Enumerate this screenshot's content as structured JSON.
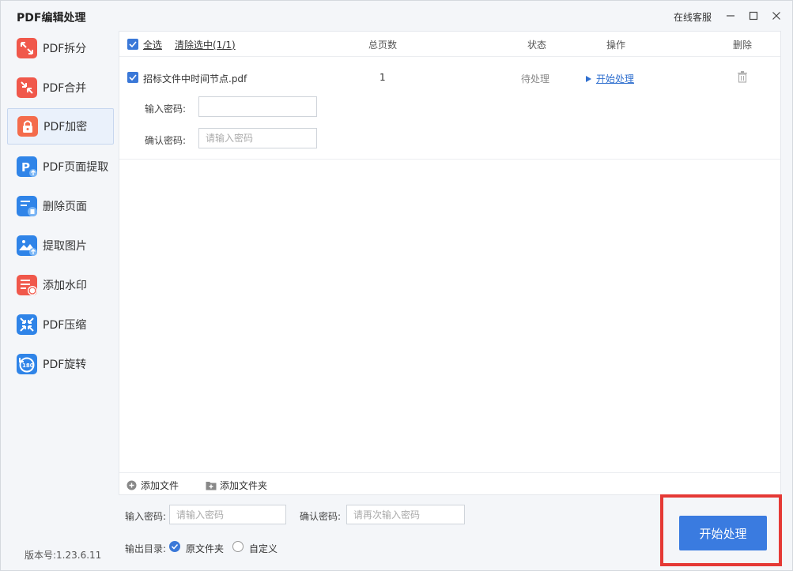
{
  "window": {
    "title": "PDF编辑处理",
    "service": "在线客服"
  },
  "sidebar": {
    "items": [
      {
        "label": "PDF拆分",
        "icon": "split-icon",
        "color": "#f0584b"
      },
      {
        "label": "PDF合并",
        "icon": "merge-icon",
        "color": "#f0584b"
      },
      {
        "label": "PDF加密",
        "icon": "lock-icon",
        "color": "#f46c4c",
        "active": true
      },
      {
        "label": "PDF页面提取",
        "icon": "page-extract-icon",
        "color": "#2f84e8"
      },
      {
        "label": "删除页面",
        "icon": "delete-page-icon",
        "color": "#2f84e8"
      },
      {
        "label": "提取图片",
        "icon": "image-extract-icon",
        "color": "#2f84e8"
      },
      {
        "label": "添加水印",
        "icon": "watermark-icon",
        "color": "#f0584b"
      },
      {
        "label": "PDF压缩",
        "icon": "compress-icon",
        "color": "#2f84e8"
      },
      {
        "label": "PDF旋转",
        "icon": "rotate-icon",
        "color": "#2f84e8"
      }
    ],
    "version": "版本号:1.23.6.11"
  },
  "list": {
    "select_all": "全选",
    "clear_selection": "清除选中(1/1)",
    "col_pages": "总页数",
    "col_status": "状态",
    "col_action": "操作",
    "col_delete": "删除",
    "files": [
      {
        "name": "招标文件中时间节点.pdf",
        "pages": "1",
        "status": "待处理",
        "action": "开始处理",
        "password_label": "输入密码:",
        "password_value": "",
        "confirm_label": "确认密码:",
        "confirm_placeholder": "请输入密码"
      }
    ],
    "add_file": "添加文件",
    "add_folder": "添加文件夹"
  },
  "bottom": {
    "password_label": "输入密码:",
    "password_placeholder": "请输入密码",
    "confirm_label": "确认密码:",
    "confirm_placeholder": "请再次输入密码",
    "output_label": "输出目录:",
    "option_original": "原文件夹",
    "option_custom": "自定义",
    "start_button": "开始处理"
  },
  "colors": {
    "accent": "#3a7be0",
    "highlight": "#e53935"
  }
}
